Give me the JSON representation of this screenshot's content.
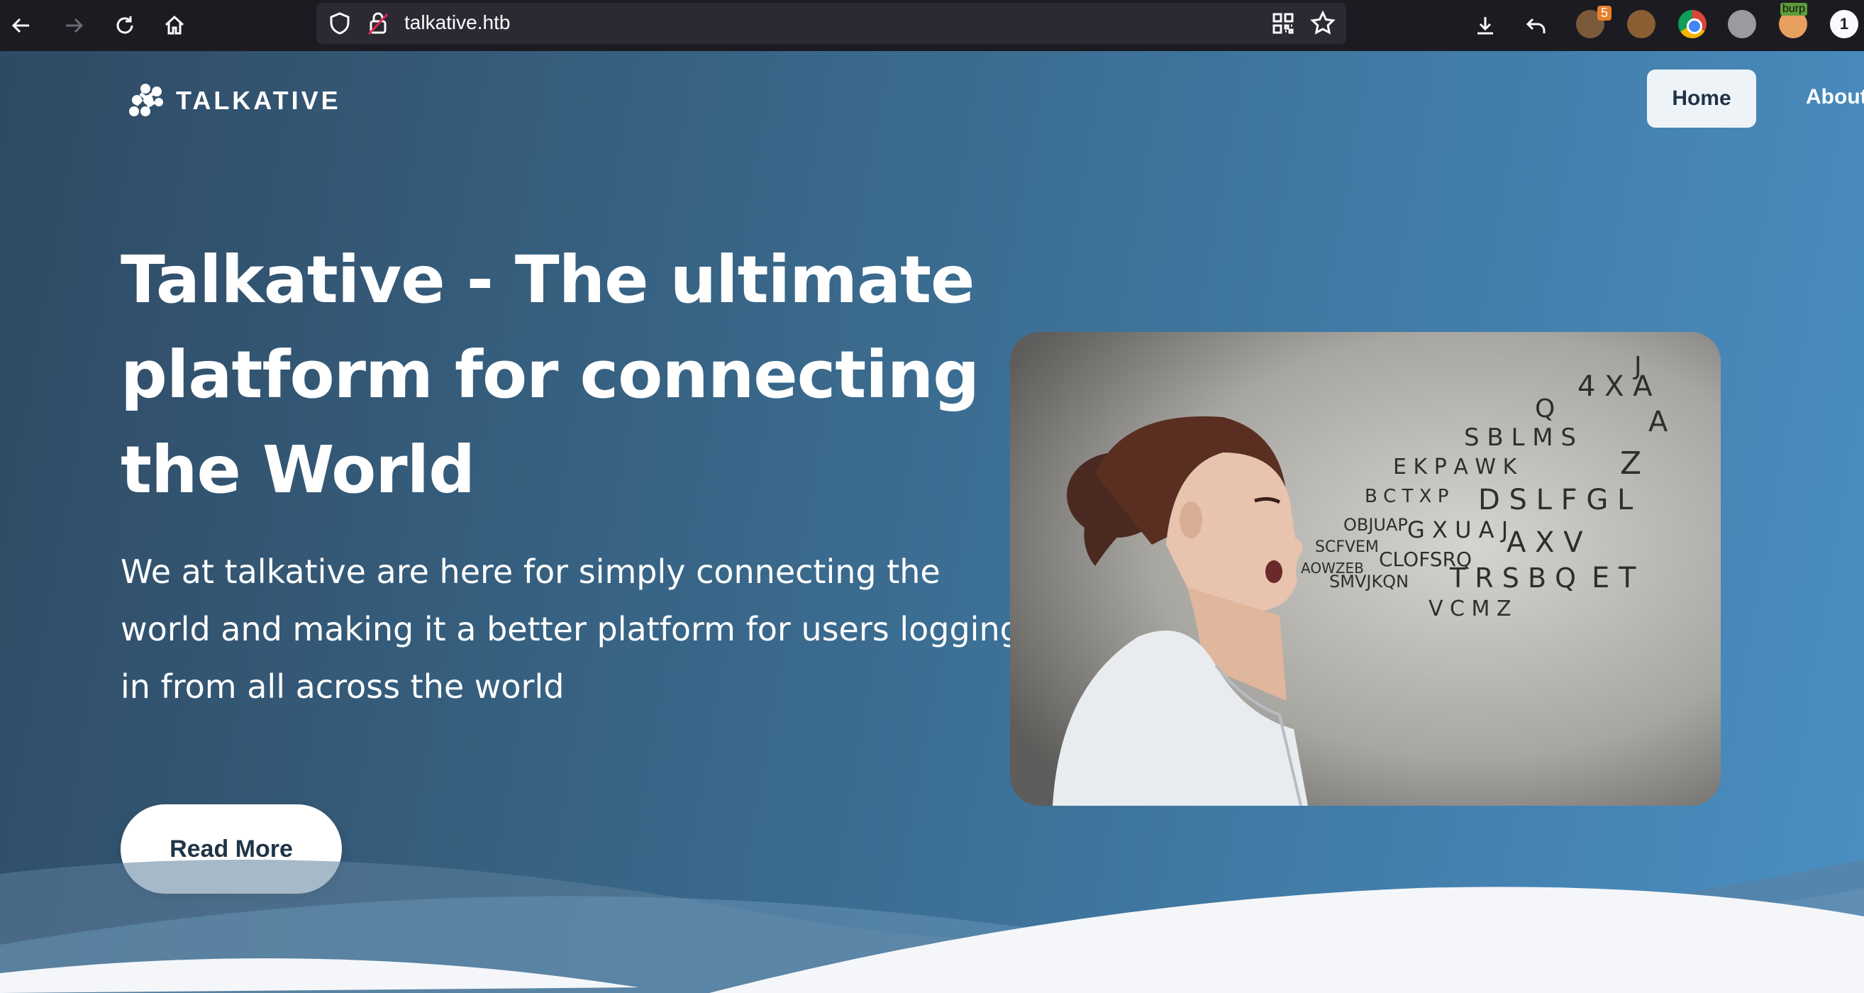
{
  "browser": {
    "url": "talkative.htb",
    "extension_badge": "5",
    "burp_label": "burp",
    "account_badge": "1",
    "icons": [
      "back-arrow-icon",
      "forward-arrow-icon",
      "reload-icon",
      "home-icon",
      "shield-icon",
      "lock-icon",
      "qr-code-icon",
      "bookmark-star-icon",
      "download-icon",
      "undo-icon",
      "extension-icon",
      "monkey-icon",
      "chrome-icon",
      "gear-icon",
      "burp-icon",
      "account-icon"
    ]
  },
  "site": {
    "logo_text": "TALKATIVE",
    "nav": {
      "home": "Home",
      "about": "About"
    },
    "headline": "Talkative - The ultimate platform for connecting the World",
    "subtext": "We at talkative are here for simply connecting the world and making it a better platform for users logging in from all across the world",
    "cta": "Read More"
  },
  "colors": {
    "chrome_bg": "#1c1b22",
    "urlbar_bg": "#2b2a33",
    "hero_start": "#2f4a63",
    "hero_end": "#4a8fc3",
    "button_bg": "#ffffff",
    "button_text": "#1f3447"
  }
}
